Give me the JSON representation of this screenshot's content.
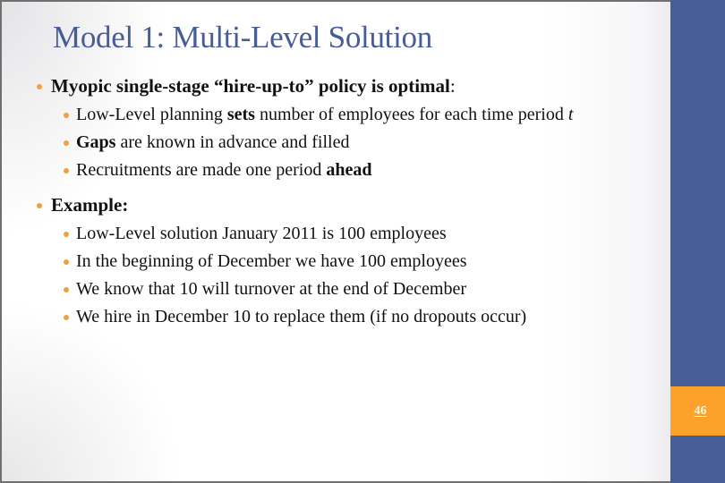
{
  "slide": {
    "title": "Model 1: Multi-Level Solution",
    "page_number": "46",
    "colors": {
      "title": "#465d97",
      "sidebar": "#465d97",
      "page_box": "#fca12b",
      "bullet": "#f0a03c",
      "text": "#111111"
    }
  },
  "bullets": [
    {
      "level": 1,
      "segments": {
        "s0": "Myopic single-stage “hire-up-to” policy is optimal",
        "s1": ":"
      },
      "children": [
        {
          "segments": {
            "s0": "Low-Level planning ",
            "s1": "sets",
            "s2": " number of employees for each time period ",
            "s3": "t"
          }
        },
        {
          "segments": {
            "s0": "Gaps",
            "s1": " are known in advance and filled"
          }
        },
        {
          "segments": {
            "s0": "Recruitments are made one period ",
            "s1": "ahead"
          }
        }
      ]
    },
    {
      "level": 1,
      "segments": {
        "s0": "Example:"
      },
      "children": [
        {
          "text": "Low-Level solution January 2011 is 100 employees"
        },
        {
          "text": "In the beginning of December we have 100 employees"
        },
        {
          "text": "We know that 10 will turnover at the end of December"
        },
        {
          "text": "We hire in December 10 to replace them (if no dropouts occur)"
        }
      ]
    }
  ]
}
